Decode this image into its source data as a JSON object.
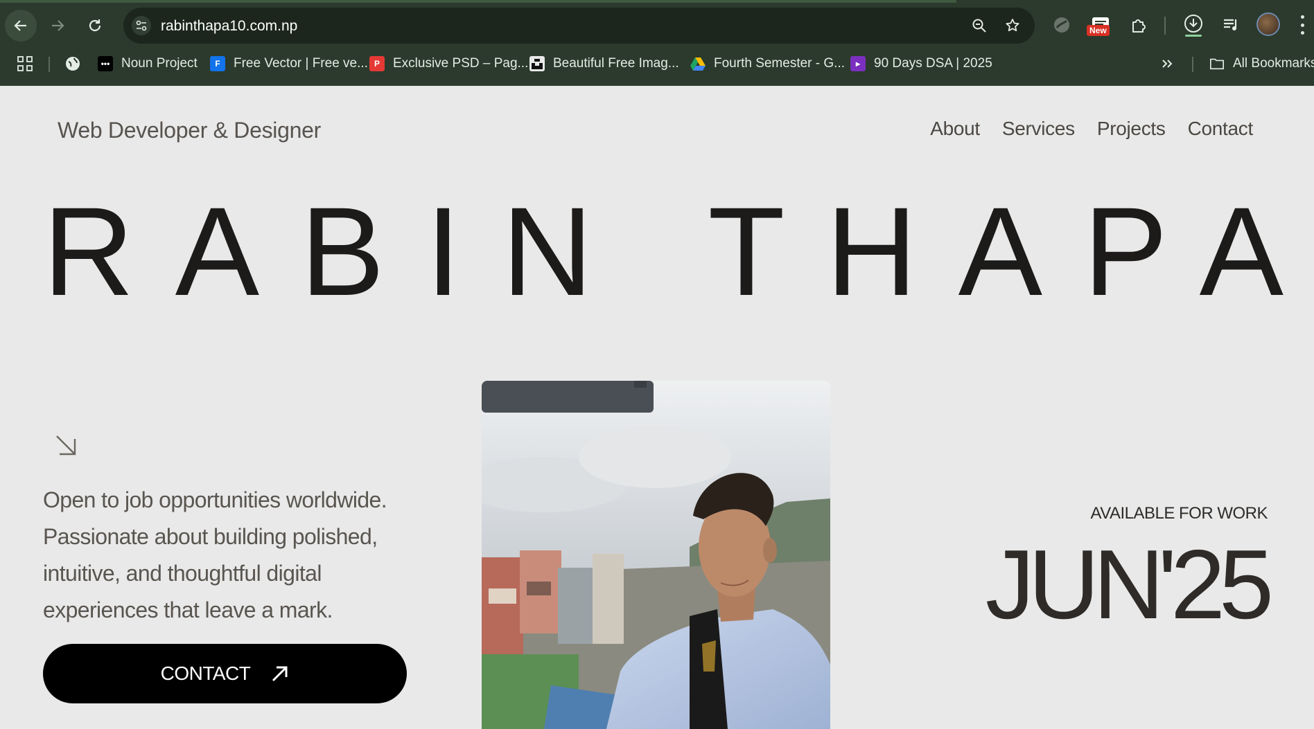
{
  "browser": {
    "url": "rabinthapa10.com.np",
    "new_badge": "New",
    "bookmarks": [
      {
        "label": "Noun Project",
        "icon": "noun-project-icon",
        "color": "#000000"
      },
      {
        "label": "Free Vector | Free ve...",
        "icon": "freepik-icon",
        "color": "#1273eb"
      },
      {
        "label": "Exclusive PSD – Pag...",
        "icon": "psd-icon",
        "color": "#e53935"
      },
      {
        "label": "Beautiful Free Imag...",
        "icon": "unsplash-icon",
        "color": "#111111"
      },
      {
        "label": "Fourth Semester - G...",
        "icon": "google-drive-icon",
        "color": "#1fa463"
      },
      {
        "label": "90 Days DSA | 2025",
        "icon": "video-icon",
        "color": "#7b2fbf"
      }
    ],
    "all_bookmarks": "All Bookmarks"
  },
  "site": {
    "brand": "Web Developer & Designer",
    "nav": [
      "About",
      "Services",
      "Projects",
      "Contact"
    ],
    "hero_name": "RABIN THAPA",
    "pitch_lines": [
      "Open to job opportunities worldwide.",
      "Passionate about building polished,",
      "intuitive, and thoughtful digital",
      "experiences that leave a mark."
    ],
    "contact_label": "CONTACT",
    "available_label": "AVAILABLE FOR WORK",
    "available_date": "JUN'25"
  },
  "colors": {
    "chrome_bg": "#2b3a2c",
    "page_bg": "#e9e9e9",
    "text_dark": "#1c1b1a",
    "button_bg": "#000000"
  }
}
